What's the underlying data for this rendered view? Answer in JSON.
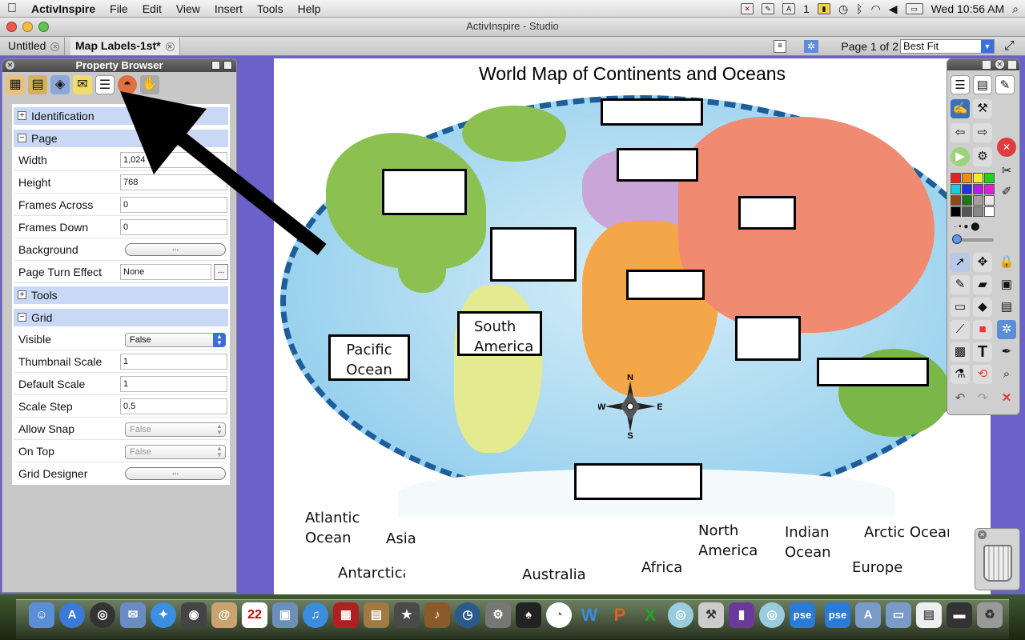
{
  "menubar": {
    "app_name": "ActivInspire",
    "items": [
      "File",
      "Edit",
      "View",
      "Insert",
      "Tools",
      "Help"
    ],
    "status_number": "1",
    "clock": "Wed 10:56 AM"
  },
  "window": {
    "title": "ActivInspire - Studio"
  },
  "tabs": [
    {
      "label": "Untitled"
    },
    {
      "label": "Map Labels-1st*"
    }
  ],
  "pager": {
    "page_indicator": "Page 1 of 2",
    "zoom": "Best Fit"
  },
  "property_browser": {
    "title": "Property Browser",
    "sections": {
      "identification": "Identification",
      "page": "Page",
      "tools": "Tools",
      "grid": "Grid"
    },
    "page_rows": [
      {
        "label": "Width",
        "value": "1,024"
      },
      {
        "label": "Height",
        "value": "768"
      },
      {
        "label": "Frames Across",
        "value": "0"
      },
      {
        "label": "Frames Down",
        "value": "0"
      }
    ],
    "background": {
      "label": "Background",
      "button": "..."
    },
    "page_turn": {
      "label": "Page Turn Effect",
      "value": "None",
      "button": "..."
    },
    "grid_rows": {
      "visible": {
        "label": "Visible",
        "value": "False"
      },
      "thumbnail_scale": {
        "label": "Thumbnail Scale",
        "value": "1"
      },
      "default_scale": {
        "label": "Default Scale",
        "value": "1"
      },
      "scale_step": {
        "label": "Scale Step",
        "value": "0.5"
      },
      "allow_snap": {
        "label": "Allow Snap",
        "value": "False"
      },
      "on_top": {
        "label": "On Top",
        "value": "False"
      },
      "grid_designer": {
        "label": "Grid Designer",
        "button": "..."
      }
    }
  },
  "canvas": {
    "title": "World Map of Continents and Oceans",
    "placed_labels": [
      {
        "line1": "Pacific",
        "line2": "Ocean"
      },
      {
        "line1": "South",
        "line2": "America"
      }
    ],
    "compass": {
      "n": "N",
      "s": "S",
      "e": "E",
      "w": "W"
    },
    "word_bank": {
      "atlantic_1": "Atlantic",
      "atlantic_2": "Ocean",
      "asia": "Asia",
      "antarctica": "Antarctica",
      "australia": "Australia",
      "africa": "Africa",
      "north_america_1": "North",
      "north_america_2": "America",
      "indian_1": "Indian",
      "indian_2": "Ocean",
      "arctic": "Arctic Ocean",
      "europe": "Europe"
    }
  },
  "toolbox": {
    "text_tool": "T"
  },
  "dock": {
    "calendar_day": "22",
    "pse_1": "pse",
    "pse_2": "pse"
  },
  "colors": {
    "page_bg": "#6a62c9",
    "section_header": "#c9d8f5",
    "ocean": "#9bd2ee",
    "north_america": "#8cc152",
    "south_america": "#e3ea8f",
    "africa": "#f4a748",
    "europe": "#c9a5d8",
    "asia": "#f08a70",
    "australia": "#7ab648"
  }
}
